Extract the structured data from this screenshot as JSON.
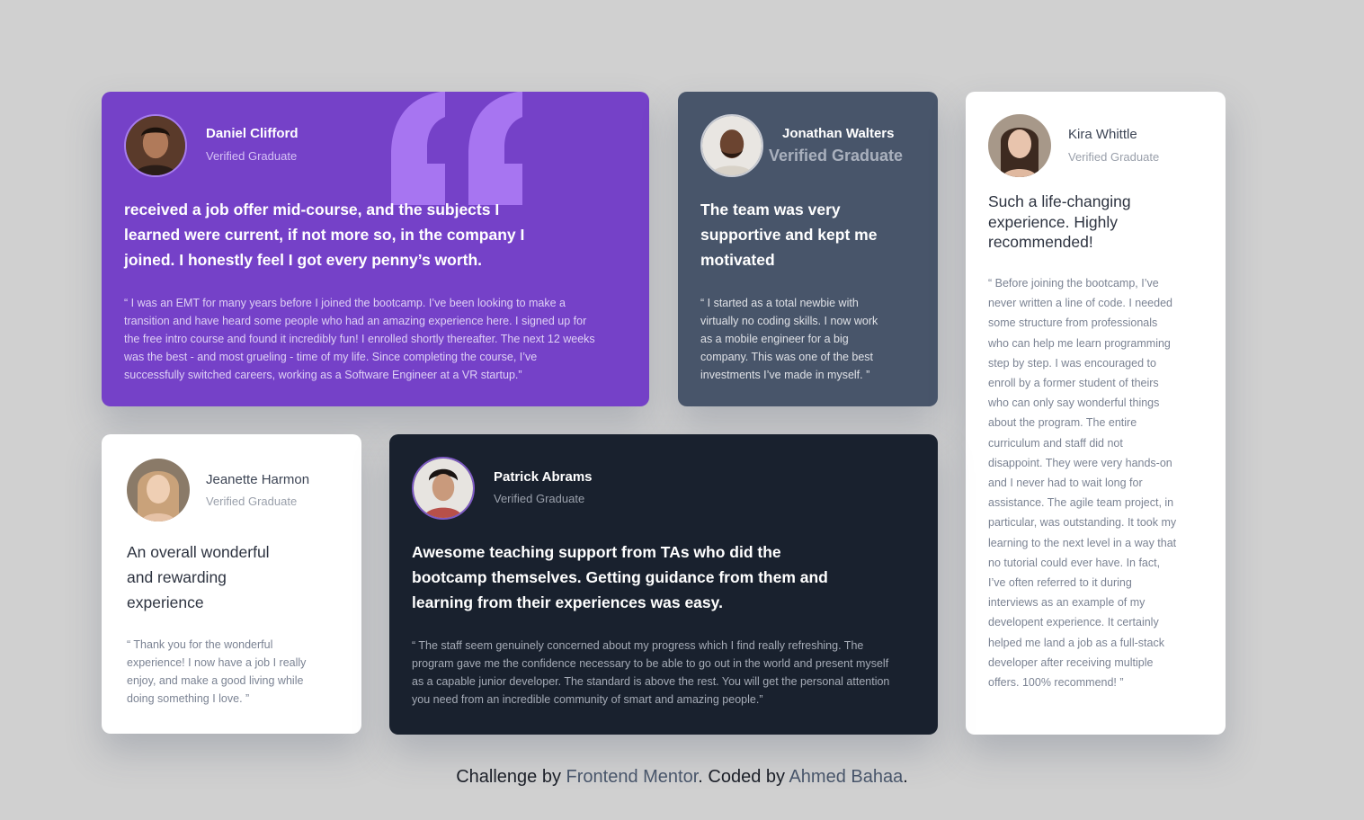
{
  "colors": {
    "page_background": "#d0d0d0",
    "purple": "#7541c8",
    "gray_blue": "#48556a",
    "dark_blue": "#19212e",
    "white": "#ffffff",
    "link": "#48556a"
  },
  "icons": {
    "quote_icon": "quotation-mark"
  },
  "testimonials": {
    "daniel": {
      "name": "Daniel Clifford",
      "role": "Verified Graduate",
      "headline": "received a job offer mid-course, and the subjects I learned were current, if not more so, in the company I joined. I honestly feel I got every penny’s worth.",
      "quote": "“ I was an EMT for many years before I joined the bootcamp. I’ve been looking to make a transition and have heard some people who had an amazing experience here. I signed up for the free intro course and found it incredibly fun! I enrolled shortly thereafter. The next 12 weeks was the best - and most grueling - time of my life. Since completing the course, I’ve successfully switched careers, working as a Software Engineer at a VR startup.”"
    },
    "jonathan": {
      "name": "Jonathan Walters",
      "role": "Verified Graduate",
      "headline": "The team was very supportive and kept me motivated",
      "quote": "“ I started as a total newbie with virtually no coding skills. I now work as a mobile engineer for a big company. This was one of the best investments I’ve made in myself. ”"
    },
    "kira": {
      "name": "Kira Whittle",
      "role": "Verified Graduate",
      "headline": "Such a life-changing experience. Highly recommended!",
      "quote": "“ Before joining the bootcamp, I’ve never written a line of code. I needed some structure from professionals who can help me learn programming step by step. I was encouraged to enroll by a former student of theirs who can only say wonderful things about the program. The entire curriculum and staff did not disappoint. They were very hands-on and I never had to wait long for assistance. The agile team project, in particular, was outstanding. It took my learning to the next level in a way that no tutorial could ever have. In fact, I’ve often referred to it during interviews as an example of my developent experience. It certainly helped me land a job as a full-stack developer after receiving multiple offers. 100% recommend! ”"
    },
    "jeanette": {
      "name": "Jeanette Harmon",
      "role": "Verified Graduate",
      "headline": "An overall wonderful and rewarding experience",
      "quote": "“ Thank you for the wonderful experience! I now have a job I really enjoy, and make a good living while doing something I love. ”"
    },
    "patrick": {
      "name": "Patrick Abrams",
      "role": "Verified Graduate",
      "headline": "Awesome teaching support from TAs who did the bootcamp themselves. Getting guidance from them and learning from their experiences was easy.",
      "quote": "“ The staff seem genuinely concerned about my progress which I find really refreshing. The program gave me the confidence necessary to be able to go out in the world and present myself as a capable junior developer. The standard is above the rest. You will get the personal attention you need from an incredible community of smart and amazing people.”"
    }
  },
  "footer": {
    "prefix": "Challenge by ",
    "link1": "Frontend Mentor",
    "middle": ". Coded by ",
    "link2": "Ahmed Bahaa",
    "suffix": "."
  }
}
